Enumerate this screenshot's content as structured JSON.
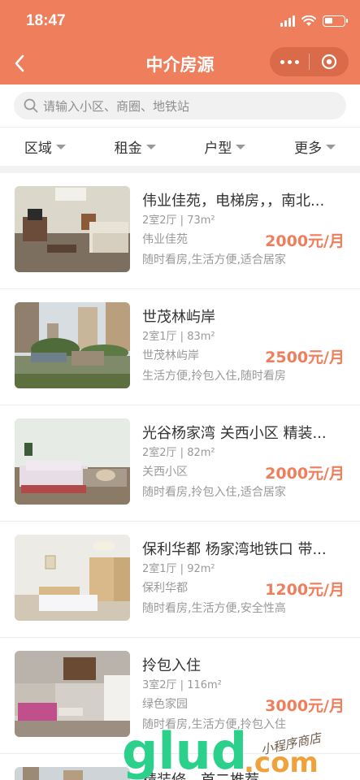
{
  "status_bar": {
    "time": "18:47"
  },
  "nav": {
    "title": "中介房源"
  },
  "search": {
    "placeholder": "请输入小区、商圈、地铁站"
  },
  "filters": [
    {
      "label": "区域"
    },
    {
      "label": "租金"
    },
    {
      "label": "户型"
    },
    {
      "label": "更多"
    }
  ],
  "listings": [
    {
      "title": "伟业佳苑，电梯房，，南北...",
      "layout": "2室2厅",
      "area": "73m²",
      "estate": "伟业佳苑",
      "price": "2000元/月",
      "tags": "随时看房,生活方便,适合居家"
    },
    {
      "title": "世茂林屿岸",
      "layout": "2室1厅",
      "area": "83m²",
      "estate": "世茂林屿岸",
      "price": "2500元/月",
      "tags": "生活方便,拎包入住,随时看房"
    },
    {
      "title": "光谷杨家湾 关西小区 精装...",
      "layout": "2室2厅",
      "area": "82m²",
      "estate": "关西小区",
      "price": "2000元/月",
      "tags": "随时看房,拎包入住,适合居家"
    },
    {
      "title": "保利华都 杨家湾地铁口 带...",
      "layout": "2室1厅",
      "area": "92m²",
      "estate": "保利华都",
      "price": "1200元/月",
      "tags": "随时看房,生活方便,安全性高"
    },
    {
      "title": "拎包入住",
      "layout": "3室2厅",
      "area": "116m²",
      "estate": "绿色家园",
      "price": "3000元/月",
      "tags": "随时看房,生活方便,拎包入住"
    },
    {
      "title": "精装修，首二推荐"
    }
  ],
  "watermark": {
    "brand": "glud",
    "domain": ".com",
    "tagline": "小程序商店"
  },
  "colors": {
    "accent": "#ee7e5c",
    "watermark_green": "#2bd18a"
  },
  "icons": [
    "back-arrow-icon",
    "more-dots-icon",
    "close-circle-icon",
    "search-icon",
    "signal-icon",
    "wifi-icon",
    "battery-icon",
    "dropdown-triangle-icon"
  ]
}
